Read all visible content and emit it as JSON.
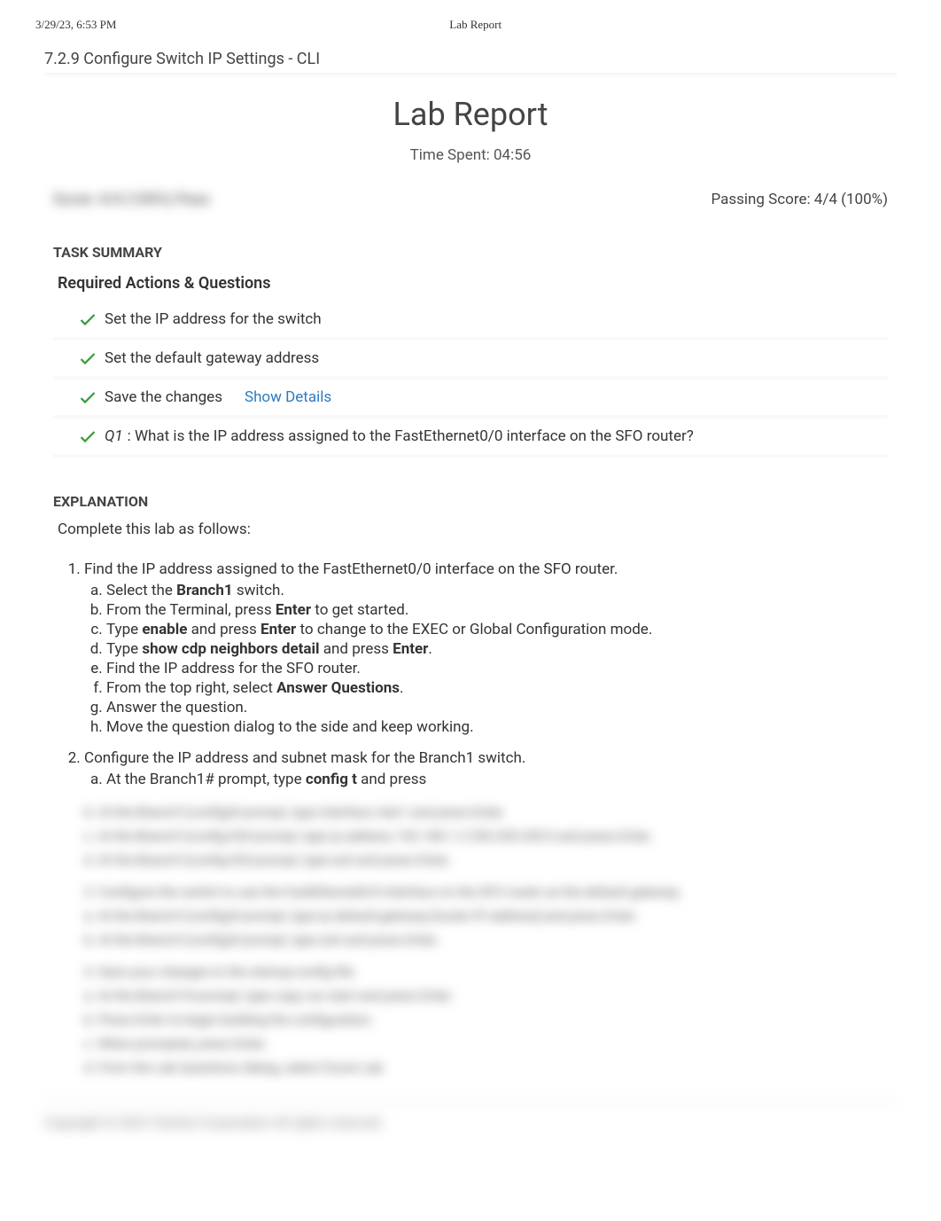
{
  "header": {
    "timestamp": "3/29/23, 6:53 PM",
    "doc_title": "Lab Report"
  },
  "lab": {
    "title": "7.2.9 Configure Switch IP Settings - CLI",
    "report_heading": "Lab Report",
    "time_spent": "Time Spent: 04:56"
  },
  "score": {
    "left_blurred": "Score: 4/4 (100%) Pass",
    "passing": "Passing Score: 4/4 (100%)"
  },
  "task_summary_label": "TASK SUMMARY",
  "required_label": "Required Actions & Questions",
  "tasks": [
    {
      "label": "Set the IP address for the switch"
    },
    {
      "label": "Set the default gateway address"
    },
    {
      "label": "Save the changes",
      "show_details": "Show Details"
    },
    {
      "q": "Q1",
      "label": ":  What is the IP address assigned to the FastEthernet0/0 interface on the SFO router?"
    }
  ],
  "explanation": {
    "title": "EXPLANATION",
    "intro": "Complete this lab as follows:",
    "step1": {
      "text": "Find the IP address assigned to the FastEthernet0/0 interface on the SFO router.",
      "a_pre": "Select the ",
      "a_bold": "Branch1",
      "a_post": " switch.",
      "b_pre": "From the Terminal, press ",
      "b_bold": "Enter",
      "b_post": " to get started.",
      "c_pre": "Type ",
      "c_bold1": "enable",
      "c_mid": " and press ",
      "c_bold2": "Enter",
      "c_post": " to change to the EXEC or Global Configuration mode.",
      "d_pre": "Type ",
      "d_bold1": "show cdp neighbors detail",
      "d_mid": " and press ",
      "d_bold2": "Enter",
      "d_post": ".",
      "e": "Find the IP address for the SFO router.",
      "f_pre": "From the top right, select ",
      "f_bold": "Answer Questions",
      "f_post": ".",
      "g": "Answer the question.",
      "h": "Move the question dialog to the side and keep working."
    },
    "step2": {
      "text": "Configure the IP address and subnet mask for the Branch1 switch.",
      "a_pre": "At the Branch1# prompt, type ",
      "a_bold": "config t",
      "a_post": " and press"
    }
  },
  "blurred": {
    "l1": "b. At the Branch1(config)# prompt, type interface vlan1 and press Enter.",
    "l2": "c. At the Branch1(config-if)# prompt, type ip address 192.168.1.2 255.255.255.0 and press Enter.",
    "l3": "d. At the Branch1(config-if)# prompt, type exit and press Enter.",
    "l4": "3. Configure the switch to use the FastEthernet0/0 interface on the SFO router as the default gateway.",
    "l5": "a. At the Branch1(config)# prompt, type ip default-gateway [router IP address] and press Enter.",
    "l6": "b. At the Branch1(config)# prompt, type exit and press Enter.",
    "l7": "4. Save your changes to the startup-config file.",
    "l8": "a. At the Branch1# prompt, type copy run start and press Enter.",
    "l9": "b. Press Enter to begin building the configuration.",
    "l10": "c. When prompted, press Enter.",
    "l11": "d. From the Lab Questions dialog, select Score Lab."
  },
  "footer": "Copyright © 2023 TestOut Corporation All rights reserved."
}
